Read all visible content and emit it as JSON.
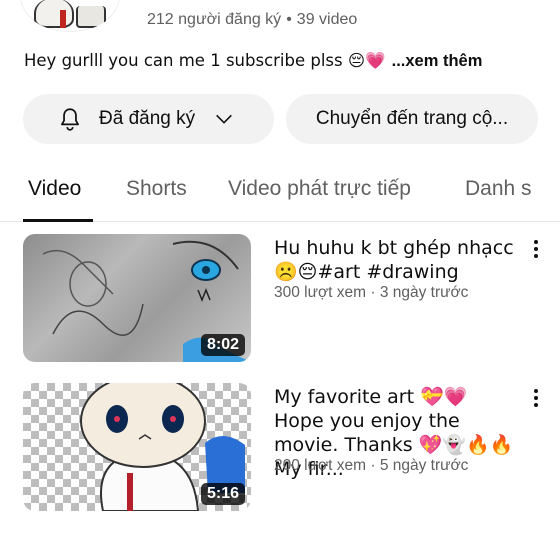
{
  "channel": {
    "subscribers": "212 người đăng ký",
    "separator": "•",
    "video_count": "39 video",
    "description": "Hey gurlll you can me 1 subscribe plss 😔💗",
    "more_label": "...xem thêm"
  },
  "actions": {
    "subscribed_label": "Đã đăng ký",
    "community_label": "Chuyển đến trang cộ..."
  },
  "tabs": [
    {
      "label": "Video",
      "active": true
    },
    {
      "label": "Shorts",
      "active": false
    },
    {
      "label": "Video phát trực tiếp",
      "active": false
    },
    {
      "label": "Danh s",
      "active": false
    }
  ],
  "videos": [
    {
      "title": "Hu huhu k bt ghép nhạcc ☹️😔#art #drawing",
      "meta": "300 lượt xem · 3 ngày trước",
      "duration": "8:02"
    },
    {
      "title": "My favorite art 💝💗 Hope you enjoy the movie. Thanks 💖👻🔥🔥My fir...",
      "meta": "200 lượt xem · 5 ngày trước",
      "duration": "5:16"
    }
  ]
}
